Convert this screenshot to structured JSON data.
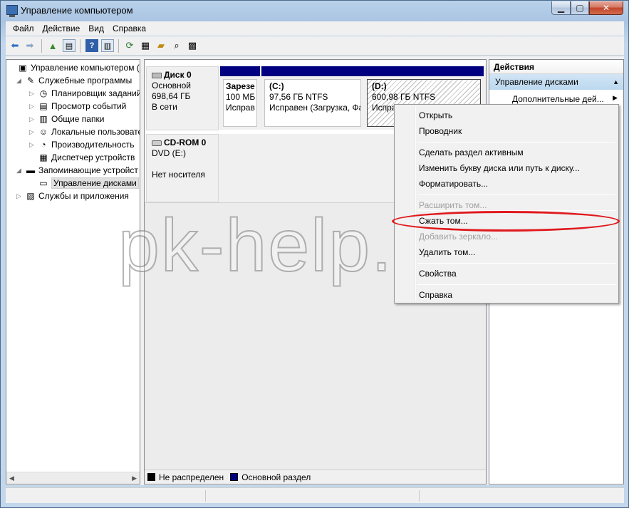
{
  "window": {
    "title": "Управление компьютером"
  },
  "menubar": [
    "Файл",
    "Действие",
    "Вид",
    "Справка"
  ],
  "tree": [
    {
      "label": "Управление компьютером (л",
      "level": 0,
      "expander": "",
      "icon": "computer-management-icon"
    },
    {
      "label": "Служебные программы",
      "level": 1,
      "expander": "◢",
      "icon": "tools-icon"
    },
    {
      "label": "Планировщик заданий",
      "level": 2,
      "expander": "▷",
      "icon": "clock-icon"
    },
    {
      "label": "Просмотр событий",
      "level": 2,
      "expander": "▷",
      "icon": "event-viewer-icon"
    },
    {
      "label": "Общие папки",
      "level": 2,
      "expander": "▷",
      "icon": "shared-folder-icon"
    },
    {
      "label": "Локальные пользовате",
      "level": 2,
      "expander": "▷",
      "icon": "users-icon"
    },
    {
      "label": "Производительность",
      "level": 2,
      "expander": "▷",
      "icon": "performance-icon"
    },
    {
      "label": "Диспетчер устройств",
      "level": 2,
      "expander": "",
      "icon": "device-manager-icon"
    },
    {
      "label": "Запоминающие устройст",
      "level": 1,
      "expander": "◢",
      "icon": "storage-icon"
    },
    {
      "label": "Управление дисками",
      "level": 2,
      "expander": "",
      "icon": "disk-management-icon",
      "selected": true
    },
    {
      "label": "Службы и приложения",
      "level": 1,
      "expander": "▷",
      "icon": "services-icon"
    }
  ],
  "disks": {
    "disk0": {
      "name": "Диск 0",
      "type": "Основной",
      "size": "698,64 ГБ",
      "status": "В сети"
    },
    "cdrom0": {
      "name": "CD-ROM 0",
      "type": "DVD (E:)",
      "status": "Нет носителя"
    }
  },
  "partitions": [
    {
      "line1": "Зарезе",
      "line2": "100 МБ",
      "line3": "Исправ"
    },
    {
      "line1": "(C:)",
      "line2": "97,56 ГБ NTFS",
      "line3": "Исправен (Загрузка, Фа"
    },
    {
      "line1": "(D:)",
      "line2": "600,98 ГБ NTFS",
      "line3": "Исправ   (Основн"
    }
  ],
  "legend": [
    {
      "label": "Не распределен",
      "color": "#000000"
    },
    {
      "label": "Основной раздел",
      "color": "#000080"
    }
  ],
  "actions": {
    "header": "Действия",
    "group": "Управление дисками",
    "more": "Дополнительные дей..."
  },
  "context_menu": [
    {
      "label": "Открыть",
      "disabled": false
    },
    {
      "label": "Проводник",
      "disabled": false
    },
    {
      "label": "Сделать раздел активным",
      "disabled": false
    },
    {
      "label": "Изменить букву диска или путь к диску...",
      "disabled": false
    },
    {
      "label": "Форматировать...",
      "disabled": false
    },
    {
      "label": "Расширить том...",
      "disabled": true
    },
    {
      "label": "Сжать том...",
      "disabled": false
    },
    {
      "label": "Добавить зеркало...",
      "disabled": true
    },
    {
      "label": "Удалить том...",
      "disabled": false
    },
    {
      "label": "Свойства",
      "disabled": false
    },
    {
      "label": "Справка",
      "disabled": false
    }
  ],
  "watermark": "pk-help.com",
  "highlight_color": "#e0191d",
  "partition_bar_color": "#000080"
}
